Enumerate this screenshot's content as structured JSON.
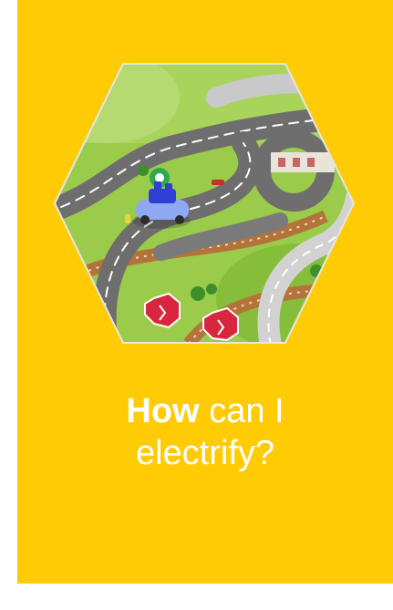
{
  "card": {
    "headline_bold": "How",
    "headline_rest_line1": "can I",
    "headline_line2": "electrify?"
  },
  "image": {
    "subject": "toy-car-on-play-mat-roads",
    "shape": "hexagon"
  },
  "colors": {
    "card_background": "#FFCB05",
    "text": "#FFFFFF",
    "mat_green": "#8CC63F",
    "road_grey": "#6E6E6E",
    "car_blue": "#2E3FD6",
    "sign_red": "#D7263D"
  }
}
